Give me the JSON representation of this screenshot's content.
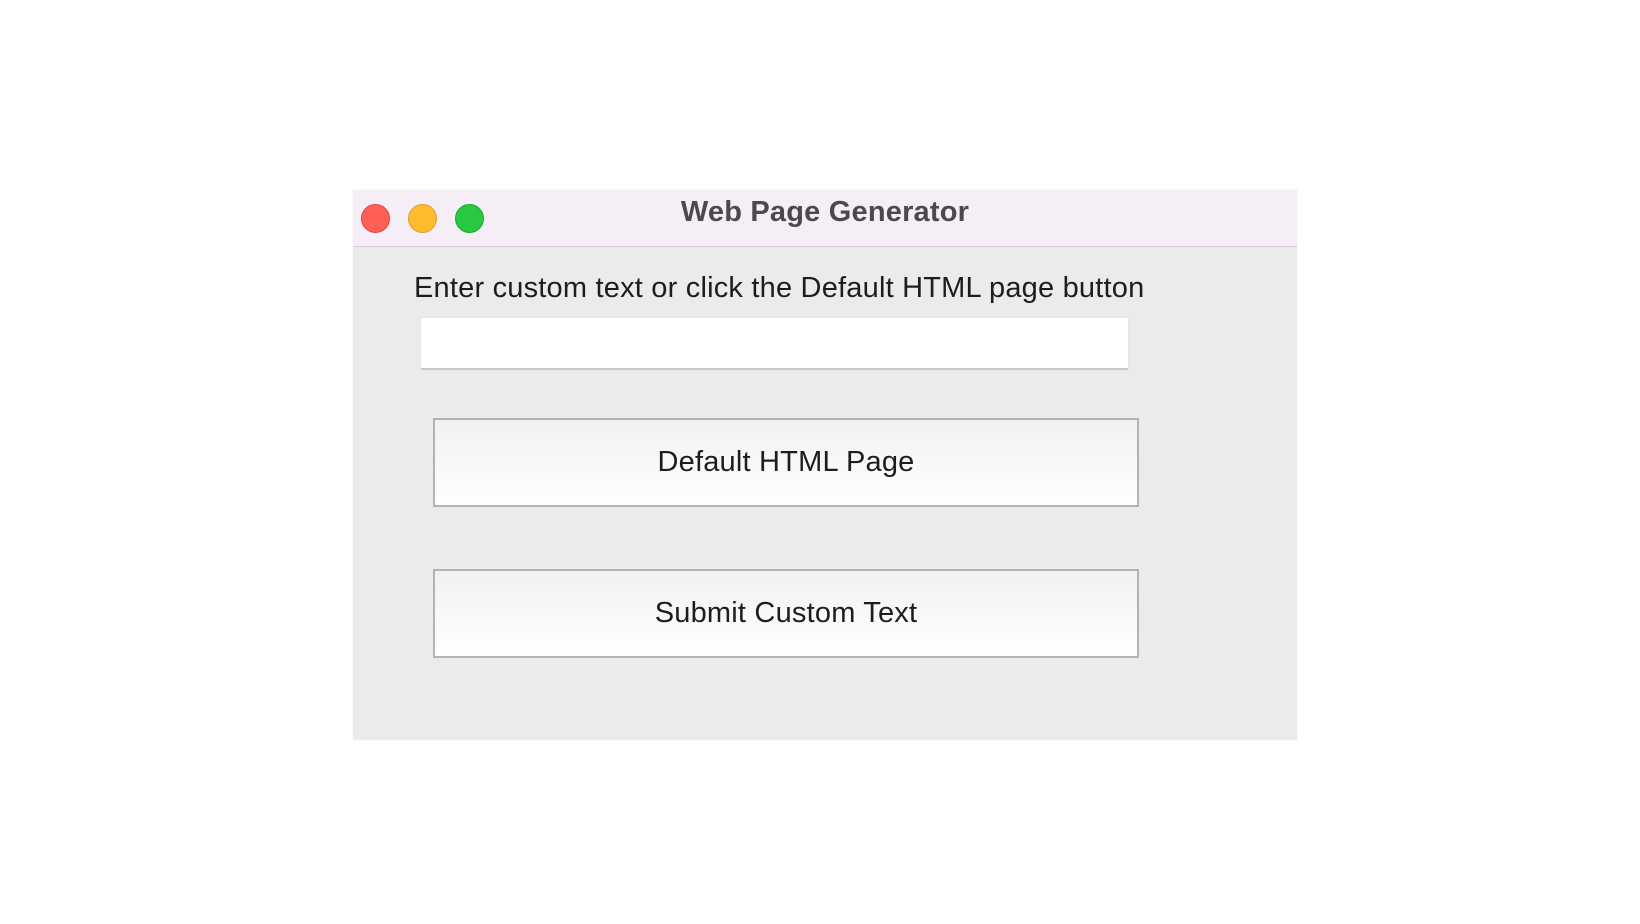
{
  "window": {
    "title": "Web Page Generator"
  },
  "form": {
    "prompt": "Enter custom text or click the Default HTML page button",
    "input_value": "",
    "default_button_label": "Default HTML Page",
    "submit_button_label": "Submit Custom Text"
  },
  "colors": {
    "close": "#fe5f57",
    "minimize": "#febc2e",
    "zoom": "#28c840",
    "titlebar": "#f6eef7",
    "window_bg": "#ebebeb"
  }
}
